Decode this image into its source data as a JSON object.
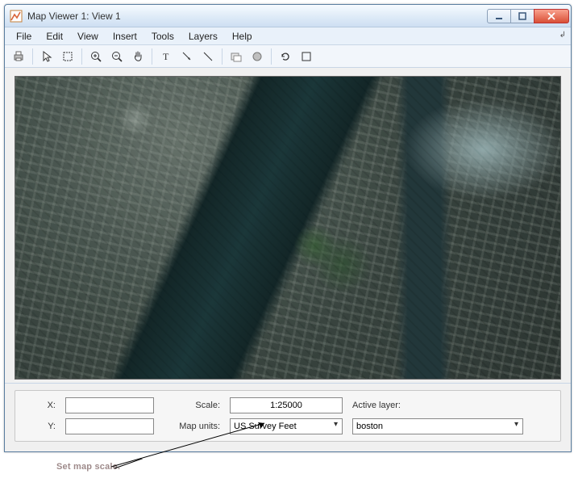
{
  "window": {
    "title": "Map Viewer 1: View 1"
  },
  "menubar": {
    "items": [
      "File",
      "Edit",
      "View",
      "Insert",
      "Tools",
      "Layers",
      "Help"
    ]
  },
  "toolbar": {
    "tools": [
      "print-icon",
      "sep",
      "pointer-icon",
      "marquee-icon",
      "sep",
      "zoom-in-icon",
      "zoom-out-icon",
      "pan-icon",
      "sep",
      "text-tool-icon",
      "arrow-tool-icon",
      "line-tool-icon",
      "sep",
      "info-icon",
      "identify-icon",
      "sep",
      "refresh-icon",
      "fit-icon"
    ]
  },
  "status": {
    "x_label": "X:",
    "y_label": "Y:",
    "x_value": "",
    "y_value": "",
    "scale_label": "Scale:",
    "scale_value": "1:25000",
    "units_label": "Map units:",
    "units_value": "US Survey Feet",
    "active_layer_label": "Active layer:",
    "active_layer_value": "boston"
  },
  "annotation": {
    "text": "Set map scale."
  }
}
